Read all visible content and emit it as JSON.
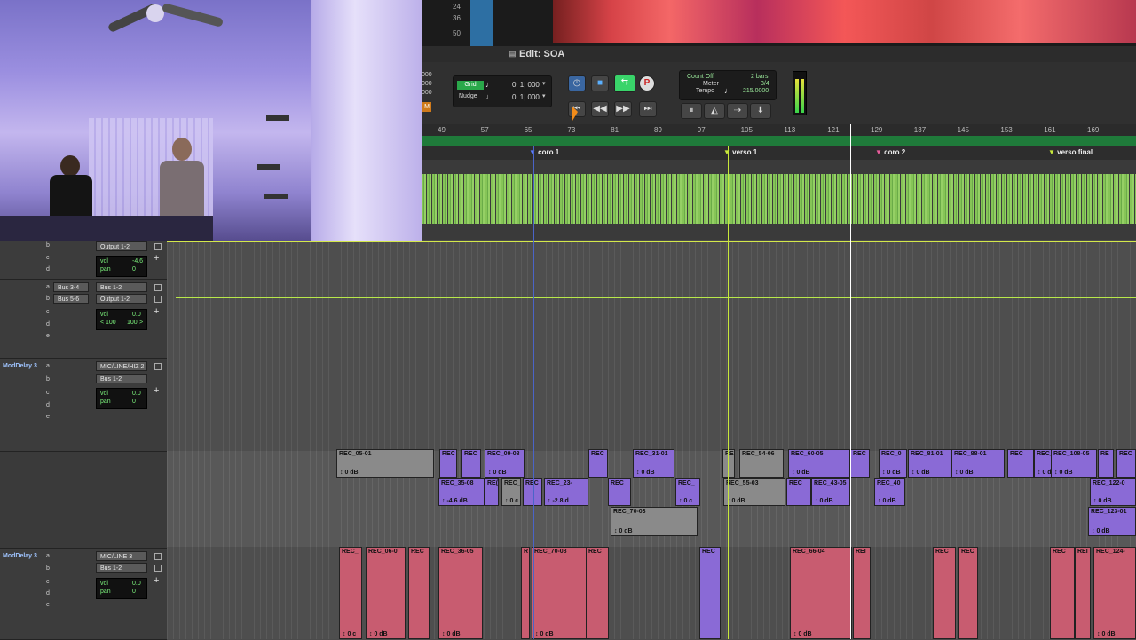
{
  "overview": {
    "scale_labels": [
      "24",
      "36",
      "50"
    ]
  },
  "window": {
    "title": "Edit: SOA"
  },
  "toolbar": {
    "grid_label": "Grid",
    "grid_value": "0| 1| 000",
    "nudge_label": "Nudge",
    "nudge_value": "0| 1| 000",
    "counter_top": "000",
    "counter_mid": "000",
    "counter_bot": "000",
    "count_off": "Count Off",
    "count_off_value": "2 bars",
    "meter": "Meter",
    "meter_value": "3/4",
    "tempo": "Tempo",
    "tempo_value": "215.0000",
    "m_badge": "M",
    "p_btn": "P",
    "return_to_zero": "⏮",
    "rewind": "◀◀",
    "fast_forward": "▶▶",
    "go_to_end": "⏭"
  },
  "ruler": {
    "bars": [
      "49",
      "57",
      "65",
      "73",
      "81",
      "89",
      "97",
      "105",
      "113",
      "121",
      "129",
      "137",
      "145",
      "153",
      "161",
      "169"
    ]
  },
  "markers": [
    {
      "label": "coro 1",
      "color": "#5b7cff"
    },
    {
      "label": "verso 1",
      "color": "#c8e83a"
    },
    {
      "label": "coro 2",
      "color": "#e85c9b"
    },
    {
      "label": "verso final",
      "color": "#c8e83a"
    }
  ],
  "tracks": [
    {
      "output": "Output 1-2",
      "vol": "-4.6",
      "pan": "0",
      "send_a": "",
      "send_b": ""
    },
    {
      "input": "Bus 1-2",
      "output": "Output 1-2",
      "send_a": "Bus 3-4",
      "send_b": "Bus 5-6",
      "vol": "0.0",
      "pan_l": "100",
      "pan_r": "100"
    },
    {
      "name": "ModDelay 3",
      "input": "MIC/LINE/HIZ 2",
      "output": "Bus 1-2",
      "vol": "0.0",
      "pan": "0"
    },
    {
      "name": "ModDelay 3",
      "input": "MIC/LINE 3",
      "output": "Bus 1-2",
      "vol": "0.0",
      "pan": "0"
    }
  ],
  "labels": {
    "vol": "vol",
    "pan": "pan",
    "a": "a",
    "b": "b",
    "c": "c",
    "d": "d",
    "e": "e",
    "plus": "+"
  },
  "clips_row1": [
    {
      "name": "REC_05-01",
      "gain": "0 dB"
    },
    {
      "name": "REC",
      "gain": ""
    },
    {
      "name": "REC",
      "gain": ""
    },
    {
      "name": "REC_09-08",
      "gain": "0 dB"
    },
    {
      "name": "REC",
      "gain": ""
    },
    {
      "name": "REC_31-01",
      "gain": "0 dB"
    },
    {
      "name": "RE",
      "gain": ""
    },
    {
      "name": "REC_54-06",
      "gain": ""
    },
    {
      "name": "REC_60-05",
      "gain": "0 dB"
    },
    {
      "name": "REC",
      "gain": ""
    },
    {
      "name": "REC_0",
      "gain": "0 dB"
    },
    {
      "name": "REC_81-01",
      "gain": "0 dB"
    },
    {
      "name": "REC_88-01",
      "gain": "0 dB"
    },
    {
      "name": "REC",
      "gain": ""
    },
    {
      "name": "REC_8",
      "gain": "0 dB"
    },
    {
      "name": "REC_108-05",
      "gain": "0 dB"
    },
    {
      "name": "RE",
      "gain": ""
    },
    {
      "name": "REC",
      "gain": ""
    }
  ],
  "clips_row2": [
    {
      "name": "REC_35-08",
      "gain": "-4.6 dB"
    },
    {
      "name": "RE(",
      "gain": ""
    },
    {
      "name": "REC_",
      "gain": "0 c"
    },
    {
      "name": "REC",
      "gain": ""
    },
    {
      "name": "REC_23-",
      "gain": "-2.8 d"
    },
    {
      "name": "REC",
      "gain": ""
    },
    {
      "name": "REC_",
      "gain": "0 c"
    },
    {
      "name": "REC_55-03",
      "gain": "0 dB"
    },
    {
      "name": "REC",
      "gain": ""
    },
    {
      "name": "REC_43-05",
      "gain": "0 dB"
    },
    {
      "name": "REC_40",
      "gain": "0 dB"
    },
    {
      "name": "REC_122-0",
      "gain": "0 dB"
    }
  ],
  "clips_row3": [
    {
      "name": "REC_70-03",
      "gain": "0 dB"
    },
    {
      "name": "REC_123-01",
      "gain": "0 dB"
    }
  ],
  "clips_row4": [
    {
      "name": "REC_",
      "gain": "0 c"
    },
    {
      "name": "REC_06-0",
      "gain": "0 dB"
    },
    {
      "name": "REC",
      "gain": ""
    },
    {
      "name": "REC_36-05",
      "gain": "0 dB"
    },
    {
      "name": "R",
      "gain": ""
    },
    {
      "name": "REC_70-08",
      "gain": "0 dB"
    },
    {
      "name": "REC",
      "gain": ""
    },
    {
      "name": "REC",
      "gain": ""
    },
    {
      "name": "REC_66-04",
      "gain": "0 dB"
    },
    {
      "name": "REI",
      "gain": ""
    },
    {
      "name": "REC",
      "gain": ""
    },
    {
      "name": "REC",
      "gain": ""
    },
    {
      "name": "REC",
      "gain": ""
    },
    {
      "name": "REI",
      "gain": ""
    },
    {
      "name": "REC_124-",
      "gain": "0 dB"
    }
  ],
  "colors": {
    "audio_green": "#8fd45a",
    "clip_purple": "#8a6ad6",
    "clip_gray": "#8a8a8a",
    "clip_red": "#c85c70",
    "marker_bar": "#1f7a3a"
  }
}
